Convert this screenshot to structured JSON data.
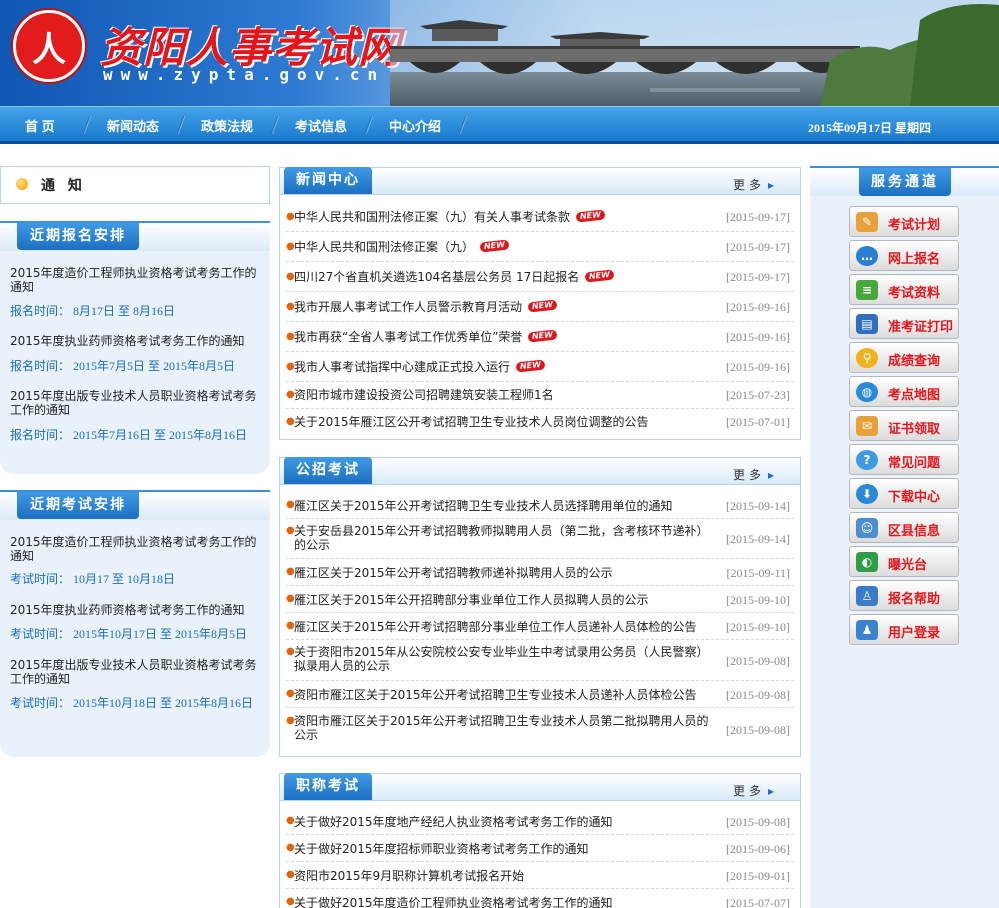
{
  "header": {
    "seal_text": "人",
    "site_name": "资阳人事考试网",
    "domain": "www.zypta.gov.cn"
  },
  "nav": {
    "items": [
      "首 页",
      "新闻动态",
      "政策法规",
      "考试信息",
      "中心介绍"
    ],
    "date": "2015年09月17日  星期四"
  },
  "notice": {
    "title": "通 知"
  },
  "recent_registration": {
    "title": "近期报名安排",
    "items": [
      {
        "text": "2015年度造价工程师执业资格考试考务工作的通知",
        "time": "报名时间：  8月17日  至  8月16日"
      },
      {
        "text": "2015年度执业药师资格考试考务工作的通知",
        "time": "报名时间：  2015年7月5日  至  2015年8月5日"
      },
      {
        "text": "2015年度出版专业技术人员职业资格考试考务工作的通知",
        "time": "报名时间：  2015年7月16日  至  2015年8月16日"
      }
    ]
  },
  "recent_exams": {
    "title": "近期考试安排",
    "items": [
      {
        "text": "2015年度造价工程师执业资格考试考务工作的通知",
        "time": "考试时间：  10月17 至  10月18日"
      },
      {
        "text": "2015年度执业药师资格考试考务工作的通知",
        "time": "考试时间：  2015年10月17日  至  2015年8月5日"
      },
      {
        "text": "2015年度出版专业技术人员职业资格考试考务工作的通知",
        "time": "考试时间：  2015年10月18日  至  2015年8月16日"
      }
    ]
  },
  "news_center": {
    "title": "新闻中心",
    "more": "更多",
    "new_badge": "NEW",
    "rows": [
      {
        "text": "中华人民共和国刑法修正案（九）有关人事考试条款",
        "date": "[2015-09-17]",
        "is_new": true
      },
      {
        "text": "中华人民共和国刑法修正案（九）",
        "date": "[2015-09-17]",
        "is_new": true
      },
      {
        "text": "四川27个省直机关遴选104名基层公务员  17日起报名",
        "date": "[2015-09-17]",
        "is_new": true
      },
      {
        "text": "我市开展人事考试工作人员警示教育月活动",
        "date": "[2015-09-16]",
        "is_new": true
      },
      {
        "text": "我市再获“全省人事考试工作优秀单位”荣誉",
        "date": "[2015-09-16]",
        "is_new": true
      },
      {
        "text": "我市人事考试指挥中心建成正式投入运行",
        "date": "[2015-09-16]",
        "is_new": true
      },
      {
        "text": "资阳市城市建设投资公司招聘建筑安装工程师1名",
        "date": "[2015-07-23]",
        "is_new": false
      },
      {
        "text": "关于2015年雁江区公开考试招聘卫生专业技术人员岗位调整的公告",
        "date": "[2015-07-01]",
        "is_new": false
      }
    ]
  },
  "public_recruit": {
    "title": "公招考试",
    "more": "更多",
    "rows": [
      {
        "text": "雁江区关于2015年公开考试招聘卫生专业技术人员选择聘用单位的通知",
        "date": "[2015-09-14]"
      },
      {
        "text": "关于安岳县2015年公开考试招聘教师拟聘用人员（第二批，含考核环节递补）的公示",
        "date": "[2015-09-14]"
      },
      {
        "text": "雁江区关于2015年公开考试招聘教师递补拟聘用人员的公示",
        "date": "[2015-09-11]"
      },
      {
        "text": "雁江区关于2015年公开招聘部分事业单位工作人员拟聘人员的公示",
        "date": "[2015-09-10]"
      },
      {
        "text": "雁江区关于2015年公开考试招聘部分事业单位工作人员递补人员体检的公告",
        "date": "[2015-09-10]"
      },
      {
        "text": "关于资阳市2015年从公安院校公安专业毕业生中考试录用公务员（人民警察）拟录用人员的公示",
        "date": "[2015-09-08]"
      },
      {
        "text": "资阳市雁江区关于2015年公开考试招聘卫生专业技术人员递补人员体检公告",
        "date": "[2015-09-08]"
      },
      {
        "text": "资阳市雁江区关于2015年公开考试招聘卫生专业技术人员第二批拟聘用人员的公示",
        "date": "[2015-09-08]"
      }
    ]
  },
  "title_exams": {
    "title": "职称考试",
    "more": "更多",
    "rows": [
      {
        "text": "关于做好2015年度地产经纪人执业资格考试考务工作的通知",
        "date": "[2015-09-08]"
      },
      {
        "text": "关于做好2015年度招标师职业资格考试考务工作的通知",
        "date": "[2015-09-06]"
      },
      {
        "text": "资阳市2015年9月职称计算机考试报名开始",
        "date": "[2015-09-01]"
      },
      {
        "text": "关于做好2015年度造价工程师执业资格考试考务工作的通知",
        "date": "[2015-07-07]"
      }
    ]
  },
  "service": {
    "title": "服务通道",
    "buttons": [
      {
        "label": "考试计划",
        "icon": "pencil-icon",
        "color": "#e8a13a"
      },
      {
        "label": "网上报名",
        "icon": "chat-icon",
        "color": "#2a7fd4"
      },
      {
        "label": "考试资料",
        "icon": "books-icon",
        "color": "#49a83c"
      },
      {
        "label": "准考证打印",
        "icon": "printer-icon",
        "color": "#2f6fbf"
      },
      {
        "label": "成绩查询",
        "icon": "search-icon",
        "color": "#f0b320"
      },
      {
        "label": "考点地图",
        "icon": "globe-icon",
        "color": "#2a8ad6"
      },
      {
        "label": "证书领取",
        "icon": "certificate-icon",
        "color": "#e8a13a"
      },
      {
        "label": "常见问题",
        "icon": "question-icon",
        "color": "#3f9be0"
      },
      {
        "label": "下载中心",
        "icon": "download-icon",
        "color": "#2a8ad6"
      },
      {
        "label": "区县信息",
        "icon": "people-icon",
        "color": "#4c8fd0"
      },
      {
        "label": "曝光台",
        "icon": "exposure-icon",
        "color": "#2e9e46"
      },
      {
        "label": "报名帮助",
        "icon": "help-person-icon",
        "color": "#3a7cc9"
      },
      {
        "label": "用户登录",
        "icon": "users-icon",
        "color": "#3b83cf"
      }
    ]
  }
}
